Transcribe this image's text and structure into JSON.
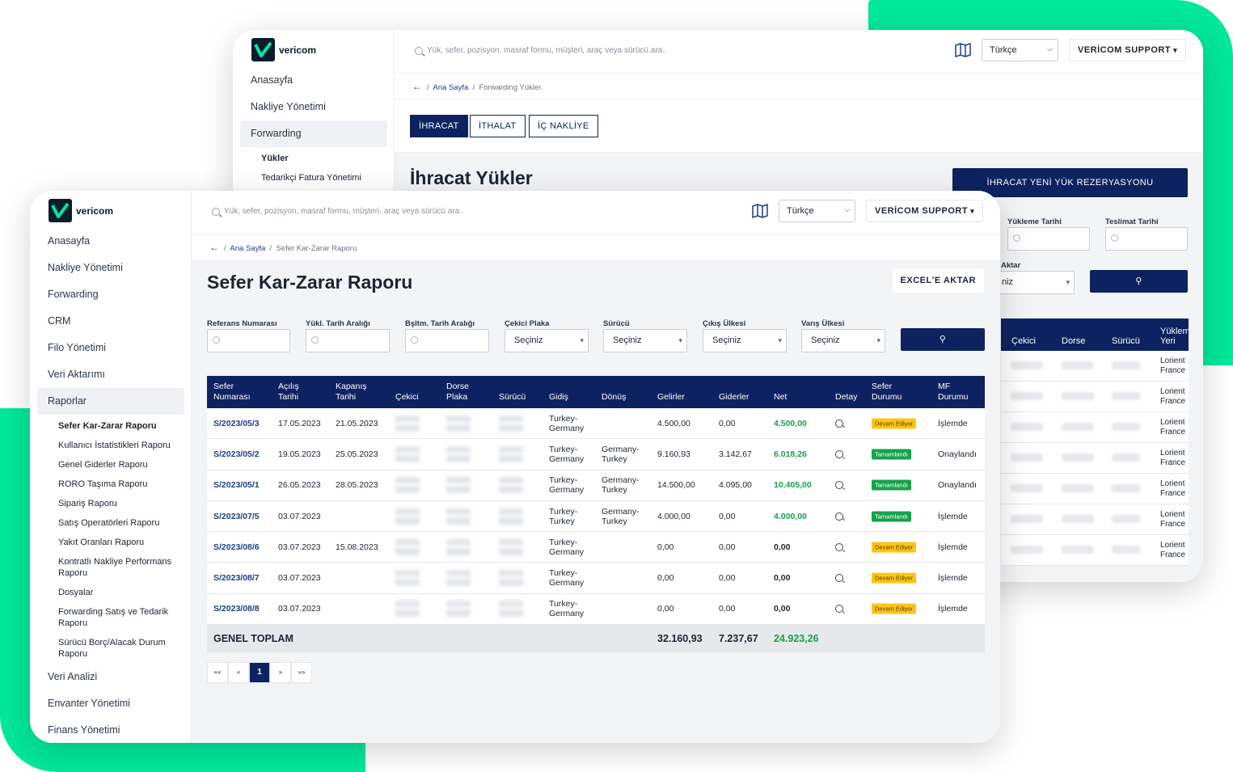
{
  "brand": {
    "name": "vericom"
  },
  "back": {
    "nav": [
      {
        "label": "Anasayfa"
      },
      {
        "label": "Nakliye Yönetimi"
      },
      {
        "label": "Forwarding"
      }
    ],
    "nav_sub": [
      {
        "label": "Yükler"
      },
      {
        "label": "Tedarikçi Fatura Yönetimi"
      }
    ],
    "search_placeholder": "Yük, sefer, pozisyon, masraf formu, müşteri, araç veya sürücü ara..",
    "language": "Türkçe",
    "support": "VERİCOM SUPPORT",
    "breadcrumb": {
      "home": "Ana Sayfa",
      "current": "Forwarding Yükler"
    },
    "tabs": [
      {
        "label": "İHRACAT"
      },
      {
        "label": "İTHALAT"
      },
      {
        "label": "İÇ NAKLİYE"
      }
    ],
    "title": "İhracat Yükler",
    "new_button": "İHRACAT YENİ YÜK REZERYASYONU",
    "filters": {
      "yukleme": "Yükleme Tarihi",
      "teslimat": "Teslimat Tarihi",
      "aktar": "Aktar",
      "select_partial": "niz"
    },
    "columns": {
      "cekici": "Çekici",
      "dorse": "Dorse",
      "surucu": "Sürücü",
      "yukleme_yeri": "Yüklem Yeri"
    },
    "rows": [
      {
        "loc": "Lorient France"
      },
      {
        "loc": "Lorient France"
      },
      {
        "loc": "Lorient France"
      },
      {
        "loc": "Lorient France"
      },
      {
        "loc": "Lorient France"
      },
      {
        "loc": "Lorient France"
      },
      {
        "loc": "Lorient France"
      }
    ]
  },
  "front": {
    "nav": [
      {
        "label": "Anasayfa"
      },
      {
        "label": "Nakliye Yönetimi"
      },
      {
        "label": "Forwarding"
      },
      {
        "label": "CRM"
      },
      {
        "label": "Filo Yönetimi"
      },
      {
        "label": "Veri Aktarımı"
      },
      {
        "label": "Raporlar"
      }
    ],
    "nav_sub": [
      {
        "label": "Sefer Kar-Zarar Raporu"
      },
      {
        "label": "Kullanıcı İstatistikleri Raporu"
      },
      {
        "label": "Genel Giderler Raporu"
      },
      {
        "label": "RORO Taşıma Raporu"
      },
      {
        "label": "Sipariş Raporu"
      },
      {
        "label": "Satış Operatörleri Raporu"
      },
      {
        "label": "Yakıt Oranları Raporu"
      },
      {
        "label": "Kontratlı Nakliye Performans Raporu"
      },
      {
        "label": "Dosyalar"
      },
      {
        "label": "Forwarding Satış ve Tedarik Raporu"
      },
      {
        "label": "Sürücü Borç/Alacak Durum Raporu"
      }
    ],
    "nav_after": [
      {
        "label": "Veri Analizi"
      },
      {
        "label": "Envanter Yönetimi"
      },
      {
        "label": "Finans Yönetimi"
      }
    ],
    "search_placeholder": "Yük, sefer, pozisyon, masraf formu, müşteri, araç veya sürücü ara..",
    "language": "Türkçe",
    "support": "VERİCOM SUPPORT",
    "breadcrumb": {
      "home": "Ana Sayfa",
      "current": "Sefer Kar-Zarar Raporu"
    },
    "title": "Sefer Kar-Zarar Raporu",
    "excel_button": "EXCEL'E AKTAR",
    "filters": [
      {
        "label": "Referans Numarası",
        "value": ""
      },
      {
        "label": "Yükl. Tarih Aralığı",
        "value": ""
      },
      {
        "label": "Bşltm. Tarih Aralığı",
        "value": ""
      },
      {
        "label": "Çekici Plaka",
        "value": "Seçiniz"
      },
      {
        "label": "Sürücü",
        "value": "Seçiniz"
      },
      {
        "label": "Çıkış Ülkesi",
        "value": "Seçiniz"
      },
      {
        "label": "Varış Ülkesi",
        "value": "Seçiniz"
      }
    ],
    "columns": [
      "Sefer Numarası",
      "Açılış Tarihi",
      "Kapanış Tarihi",
      "Çekici",
      "Dorse Plaka",
      "Sürücü",
      "Gidiş",
      "Dönüş",
      "Gelirler",
      "Giderler",
      "Net",
      "Detay",
      "Sefer Durumu",
      "MF Durumu"
    ],
    "rows": [
      {
        "ref": "S/2023/05/3",
        "open": "17.05.2023",
        "close": "21.05.2023",
        "go": "Turkey-Germany",
        "ret": "",
        "income": "4.500,00",
        "expense": "0,00",
        "net": "4.500,00",
        "status": "Devam Ediyor",
        "mf": "İşlemde"
      },
      {
        "ref": "S/2023/05/2",
        "open": "19.05.2023",
        "close": "25.05.2023",
        "go": "Turkey-Germany",
        "ret": "Germany-Turkey",
        "income": "9.160,93",
        "expense": "3.142,67",
        "net": "6.018,26",
        "status": "Tamamlandı",
        "mf": "Onaylandı"
      },
      {
        "ref": "S/2023/05/1",
        "open": "26.05.2023",
        "close": "28.05.2023",
        "go": "Turkey-Germany",
        "ret": "Germany-Turkey",
        "income": "14.500,00",
        "expense": "4.095,00",
        "net": "10.405,00",
        "status": "Tamamlandı",
        "mf": "Onaylandı"
      },
      {
        "ref": "S/2023/07/5",
        "open": "03.07.2023",
        "close": "",
        "go": "Turkey-Turkey",
        "ret": "Germany-Turkey",
        "income": "4.000,00",
        "expense": "0,00",
        "net": "4.000,00",
        "status": "Tamamlandı",
        "mf": "İşlemde"
      },
      {
        "ref": "S/2023/08/6",
        "open": "03.07.2023",
        "close": "15.08.2023",
        "go": "Turkey-Germany",
        "ret": "",
        "income": "0,00",
        "expense": "0,00",
        "net": "0,00",
        "status": "Devam Ediyor",
        "mf": "İşlemde"
      },
      {
        "ref": "S/2023/08/7",
        "open": "03.07.2023",
        "close": "",
        "go": "Turkey-Germany",
        "ret": "",
        "income": "0,00",
        "expense": "0,00",
        "net": "0,00",
        "status": "Devam Ediyor",
        "mf": "İşlemde"
      },
      {
        "ref": "S/2023/08/8",
        "open": "03.07.2023",
        "close": "",
        "go": "Turkey-Germany",
        "ret": "",
        "income": "0,00",
        "expense": "0,00",
        "net": "0,00",
        "status": "Devam Ediyor",
        "mf": "İşlemde"
      }
    ],
    "total": {
      "label": "GENEL TOPLAM",
      "income": "32.160,93",
      "expense": "7.237,67",
      "net": "24.923,26"
    },
    "pager": {
      "first": "««",
      "prev": "«",
      "current": "1",
      "next": "»",
      "last": "»»"
    }
  },
  "colors": {
    "navy": "#0d2361",
    "accent_green": "#00e89b",
    "positive": "#16a34a",
    "warning": "#fcc419"
  }
}
